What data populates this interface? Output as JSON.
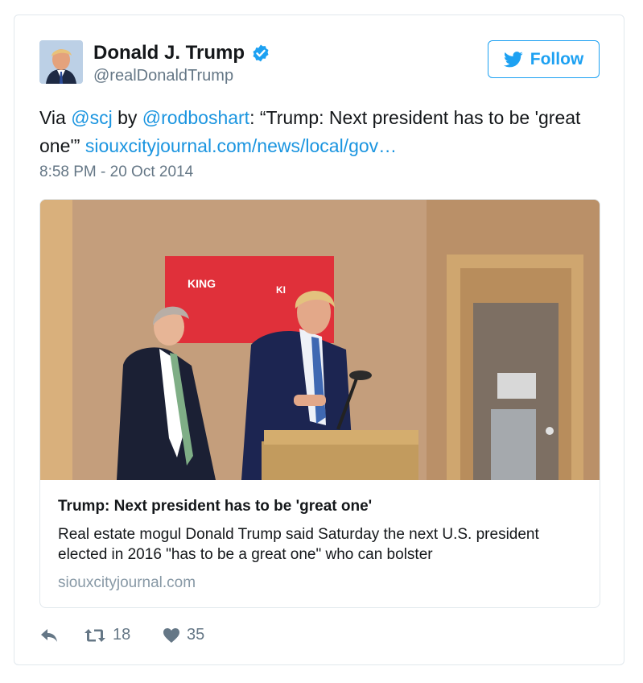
{
  "tweet": {
    "author_name": "Donald J. Trump",
    "author_handle": "@realDonaldTrump",
    "follow_label": "Follow",
    "text_prefix": "Via ",
    "mention_1": "@scj",
    "text_mid": " by ",
    "mention_2": "@rodboshart",
    "text_quote": ": “Trump: Next president has to be 'great one'” ",
    "link": "siouxcityjournal.com/news/local/gov…",
    "timestamp": "8:58 PM - 20 Oct 2014"
  },
  "card": {
    "photo_banner_1": "KING",
    "photo_banner_2": "KI",
    "title": "Trump: Next president has to be 'great one'",
    "description": "Real estate mogul Donald Trump said Saturday the next U.S. president elected in 2016 \"has to be a great one\" who can bolster",
    "domain": "siouxcityjournal.com"
  },
  "actions": {
    "reply_icon": "reply-icon",
    "retweet_icon": "retweet-icon",
    "retweet_count": "18",
    "like_icon": "heart-icon",
    "like_count": "35"
  },
  "colors": {
    "accent": "#1da1f2",
    "link": "#1b95e0",
    "secondary_text": "#657786",
    "border": "#e1e8ed"
  }
}
